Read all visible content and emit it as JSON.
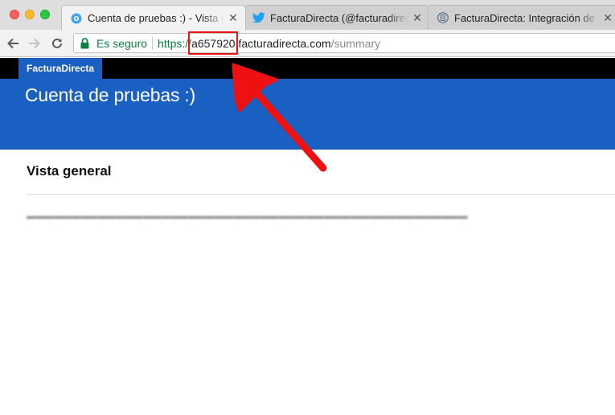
{
  "browser": {
    "tabs": [
      {
        "title": "Cuenta de pruebas :) - Vista general",
        "favicon": "facturadirecta-icon",
        "active": true
      },
      {
        "title": "FacturaDirecta (@facturadirecta)",
        "favicon": "twitter-icon",
        "active": false
      },
      {
        "title": "FacturaDirecta: Integración de",
        "favicon": "document-icon",
        "active": false
      }
    ],
    "omnibox": {
      "secure_label": "Es seguro",
      "scheme": "https://",
      "subdomain": "a657920",
      "host": ".facturadirecta.com",
      "path": "/summary"
    }
  },
  "app": {
    "brand": "FacturaDirecta",
    "account_title": "Cuenta de pruebas :)",
    "section_title": "Vista general"
  },
  "colors": {
    "brand_blue": "#1a5fc2",
    "topbar": "#000000",
    "annotation": "#ee1111",
    "secure_green": "#0b8043"
  }
}
